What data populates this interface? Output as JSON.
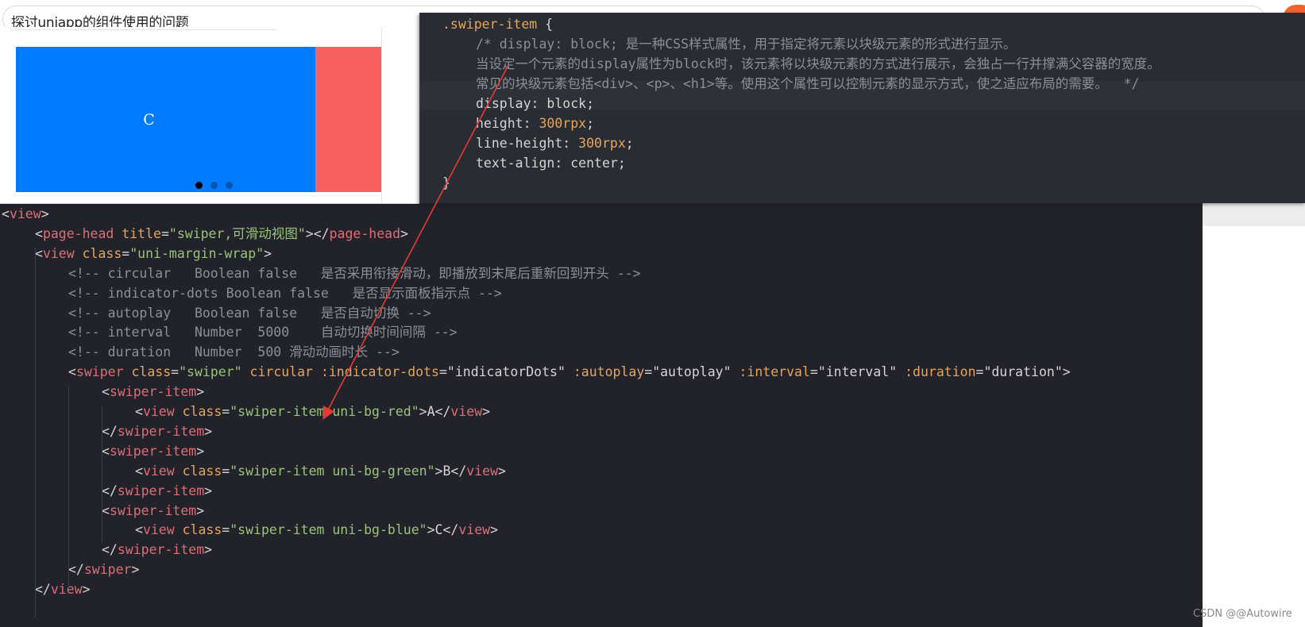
{
  "title_input": {
    "value": "探讨uniapp的组件使用的问题"
  },
  "watermark": "CSDN @@Autowire",
  "preview": {
    "slide_letter": "C",
    "colors": {
      "blue": "#007aff",
      "red": "#f76260"
    },
    "dots_total": 3,
    "dots_active_index": 0
  },
  "css_popup": {
    "lines": [
      {
        "indent": 1,
        "tokens": [
          {
            "t": ".swiper-item",
            "c": "sel"
          },
          {
            "t": " {",
            "c": "pun"
          }
        ]
      },
      {
        "indent": 2,
        "tokens": [
          {
            "t": "/* display: block; 是一种CSS样式属性，用于指定将元素以块级元素的形式进行显示。",
            "c": "com"
          }
        ]
      },
      {
        "indent": 2,
        "tokens": [
          {
            "t": "当设定一个元素的display属性为block时，该元素将以块级元素的方式进行展示，会独占一行并撑满父容器的宽度。",
            "c": "com"
          }
        ]
      },
      {
        "indent": 2,
        "tokens": [
          {
            "t": "常见的块级元素包括<div>、<p>、<h1>等。使用这个属性可以控制元素的显示方式，使之适应布局的需要。  */",
            "c": "com"
          }
        ]
      },
      {
        "indent": 2,
        "tokens": [
          {
            "t": "display",
            "c": "prop"
          },
          {
            "t": ": ",
            "c": "pun"
          },
          {
            "t": "block",
            "c": "prop"
          },
          {
            "t": ";",
            "c": "pun"
          }
        ]
      },
      {
        "indent": 2,
        "tokens": [
          {
            "t": "height",
            "c": "prop"
          },
          {
            "t": ": ",
            "c": "pun"
          },
          {
            "t": "300rpx",
            "c": "num"
          },
          {
            "t": ";",
            "c": "pun"
          }
        ]
      },
      {
        "indent": 2,
        "tokens": [
          {
            "t": "line-height",
            "c": "prop"
          },
          {
            "t": ": ",
            "c": "pun"
          },
          {
            "t": "300rpx",
            "c": "num"
          },
          {
            "t": ";",
            "c": "pun"
          }
        ]
      },
      {
        "indent": 2,
        "tokens": [
          {
            "t": "text-align",
            "c": "prop"
          },
          {
            "t": ": ",
            "c": "pun"
          },
          {
            "t": "center",
            "c": "prop"
          },
          {
            "t": ";",
            "c": "pun"
          }
        ]
      },
      {
        "indent": 1,
        "tokens": [
          {
            "t": "}",
            "c": "pun"
          }
        ]
      }
    ]
  },
  "editor": {
    "lines": [
      {
        "indent": 0,
        "tokens": [
          {
            "t": "<",
            "c": "pun"
          },
          {
            "t": "view",
            "c": "tag"
          },
          {
            "t": ">",
            "c": "pun"
          }
        ]
      },
      {
        "indent": 1,
        "tokens": [
          {
            "t": "<",
            "c": "pun"
          },
          {
            "t": "page-head",
            "c": "tag"
          },
          {
            "t": " ",
            "c": "pun"
          },
          {
            "t": "title",
            "c": "attr"
          },
          {
            "t": "=",
            "c": "pun"
          },
          {
            "t": "\"swiper,可滑动视图\"",
            "c": "str"
          },
          {
            "t": "></",
            "c": "pun"
          },
          {
            "t": "page-head",
            "c": "tag"
          },
          {
            "t": ">",
            "c": "pun"
          }
        ]
      },
      {
        "indent": 1,
        "tokens": [
          {
            "t": "<",
            "c": "pun"
          },
          {
            "t": "view",
            "c": "tag"
          },
          {
            "t": " ",
            "c": "pun"
          },
          {
            "t": "class",
            "c": "attr"
          },
          {
            "t": "=",
            "c": "pun"
          },
          {
            "t": "\"uni-margin-wrap\"",
            "c": "str"
          },
          {
            "t": ">",
            "c": "pun"
          }
        ]
      },
      {
        "indent": 2,
        "tokens": [
          {
            "t": "<!-- circular   Boolean false   是否采用衔接滑动，即播放到末尾后重新回到开头 -->",
            "c": "com"
          }
        ]
      },
      {
        "indent": 2,
        "tokens": [
          {
            "t": "<!-- indicator-dots Boolean false   是否显示面板指示点 -->",
            "c": "com"
          }
        ]
      },
      {
        "indent": 2,
        "tokens": [
          {
            "t": "<!-- autoplay   Boolean false   是否自动切换 -->",
            "c": "com"
          }
        ]
      },
      {
        "indent": 2,
        "tokens": [
          {
            "t": "<!-- interval   Number  5000    自动切换时间间隔 -->",
            "c": "com"
          }
        ]
      },
      {
        "indent": 2,
        "tokens": [
          {
            "t": "<!-- duration   Number  500 滑动动画时长 -->",
            "c": "com"
          }
        ]
      },
      {
        "indent": 2,
        "tokens": [
          {
            "t": "<",
            "c": "pun"
          },
          {
            "t": "swiper",
            "c": "tag"
          },
          {
            "t": " ",
            "c": "pun"
          },
          {
            "t": "class",
            "c": "attr"
          },
          {
            "t": "=",
            "c": "pun"
          },
          {
            "t": "\"swiper\"",
            "c": "str"
          },
          {
            "t": " ",
            "c": "pun"
          },
          {
            "t": "circular",
            "c": "attr"
          },
          {
            "t": " ",
            "c": "pun"
          },
          {
            "t": ":indicator-dots",
            "c": "attr"
          },
          {
            "t": "=",
            "c": "pun"
          },
          {
            "t": "\"indicatorDots\"",
            "c": "pun"
          },
          {
            "t": " ",
            "c": "pun"
          },
          {
            "t": ":autoplay",
            "c": "attr"
          },
          {
            "t": "=",
            "c": "pun"
          },
          {
            "t": "\"autoplay\"",
            "c": "pun"
          },
          {
            "t": " ",
            "c": "pun"
          },
          {
            "t": ":interval",
            "c": "attr"
          },
          {
            "t": "=",
            "c": "pun"
          },
          {
            "t": "\"interval\"",
            "c": "pun"
          },
          {
            "t": " ",
            "c": "pun"
          },
          {
            "t": ":duration",
            "c": "attr"
          },
          {
            "t": "=",
            "c": "pun"
          },
          {
            "t": "\"duration\"",
            "c": "pun"
          },
          {
            "t": ">",
            "c": "pun"
          }
        ]
      },
      {
        "indent": 3,
        "tokens": [
          {
            "t": "<",
            "c": "pun"
          },
          {
            "t": "swiper-item",
            "c": "tag"
          },
          {
            "t": ">",
            "c": "pun"
          }
        ]
      },
      {
        "indent": 4,
        "tokens": [
          {
            "t": "<",
            "c": "pun"
          },
          {
            "t": "view",
            "c": "tag"
          },
          {
            "t": " ",
            "c": "pun"
          },
          {
            "t": "class",
            "c": "attr"
          },
          {
            "t": "=",
            "c": "pun"
          },
          {
            "t": "\"swiper-item uni-bg-red\"",
            "c": "str"
          },
          {
            "t": ">A</",
            "c": "pun"
          },
          {
            "t": "view",
            "c": "tag"
          },
          {
            "t": ">",
            "c": "pun"
          }
        ]
      },
      {
        "indent": 3,
        "tokens": [
          {
            "t": "</",
            "c": "pun"
          },
          {
            "t": "swiper-item",
            "c": "tag"
          },
          {
            "t": ">",
            "c": "pun"
          }
        ]
      },
      {
        "indent": 3,
        "tokens": [
          {
            "t": "<",
            "c": "pun"
          },
          {
            "t": "swiper-item",
            "c": "tag"
          },
          {
            "t": ">",
            "c": "pun"
          }
        ]
      },
      {
        "indent": 4,
        "tokens": [
          {
            "t": "<",
            "c": "pun"
          },
          {
            "t": "view",
            "c": "tag"
          },
          {
            "t": " ",
            "c": "pun"
          },
          {
            "t": "class",
            "c": "attr"
          },
          {
            "t": "=",
            "c": "pun"
          },
          {
            "t": "\"swiper-item uni-bg-green\"",
            "c": "str"
          },
          {
            "t": ">B</",
            "c": "pun"
          },
          {
            "t": "view",
            "c": "tag"
          },
          {
            "t": ">",
            "c": "pun"
          }
        ]
      },
      {
        "indent": 3,
        "tokens": [
          {
            "t": "</",
            "c": "pun"
          },
          {
            "t": "swiper-item",
            "c": "tag"
          },
          {
            "t": ">",
            "c": "pun"
          }
        ]
      },
      {
        "indent": 3,
        "tokens": [
          {
            "t": "<",
            "c": "pun"
          },
          {
            "t": "swiper-item",
            "c": "tag"
          },
          {
            "t": ">",
            "c": "pun"
          }
        ]
      },
      {
        "indent": 4,
        "tokens": [
          {
            "t": "<",
            "c": "pun"
          },
          {
            "t": "view",
            "c": "tag"
          },
          {
            "t": " ",
            "c": "pun"
          },
          {
            "t": "class",
            "c": "attr"
          },
          {
            "t": "=",
            "c": "pun"
          },
          {
            "t": "\"swiper-item uni-bg-blue\"",
            "c": "str"
          },
          {
            "t": ">C</",
            "c": "pun"
          },
          {
            "t": "view",
            "c": "tag"
          },
          {
            "t": ">",
            "c": "pun"
          }
        ]
      },
      {
        "indent": 3,
        "tokens": [
          {
            "t": "</",
            "c": "pun"
          },
          {
            "t": "swiper-item",
            "c": "tag"
          },
          {
            "t": ">",
            "c": "pun"
          }
        ]
      },
      {
        "indent": 2,
        "tokens": [
          {
            "t": "</",
            "c": "pun"
          },
          {
            "t": "swiper",
            "c": "tag"
          },
          {
            "t": ">",
            "c": "pun"
          }
        ]
      },
      {
        "indent": 1,
        "tokens": [
          {
            "t": "</",
            "c": "pun"
          },
          {
            "t": "view",
            "c": "tag"
          },
          {
            "t": ">",
            "c": "pun"
          }
        ]
      }
    ]
  },
  "colors": {
    "editor_bg": "#22232a",
    "tag": "#e06c75",
    "attr": "#e5a55c",
    "string": "#98c379",
    "comment": "#8b8f99",
    "arrow": "#e53935"
  }
}
